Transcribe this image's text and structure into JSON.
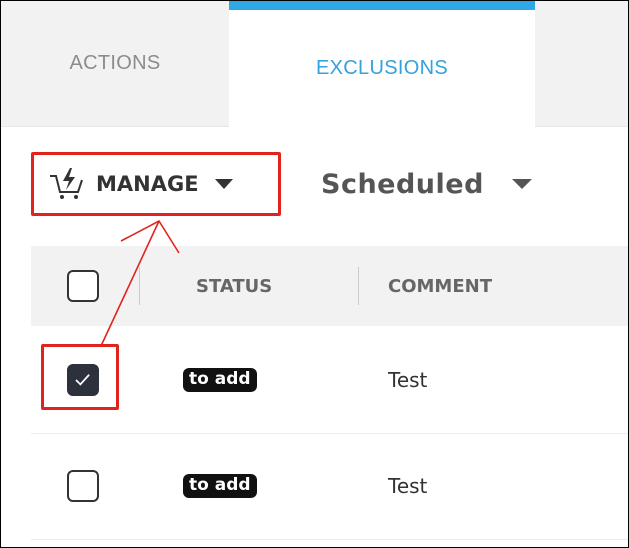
{
  "tabs": [
    {
      "label": "ACTIONS",
      "active": false
    },
    {
      "label": "EXCLUSIONS",
      "active": true
    }
  ],
  "toolbar": {
    "manage_label": "MANAGE",
    "manage_icon": "cart-bolt-icon",
    "filter_label": "Scheduled"
  },
  "table": {
    "columns": [
      "STATUS",
      "COMMENT"
    ],
    "rows": [
      {
        "checked": true,
        "status": "to add",
        "comment": "Test"
      },
      {
        "checked": false,
        "status": "to add",
        "comment": "Test"
      }
    ]
  },
  "colors": {
    "accent": "#2ea8e6",
    "active_tab_text": "#34a2dc",
    "annotation": "#e0241d",
    "badge_bg": "#111111"
  }
}
